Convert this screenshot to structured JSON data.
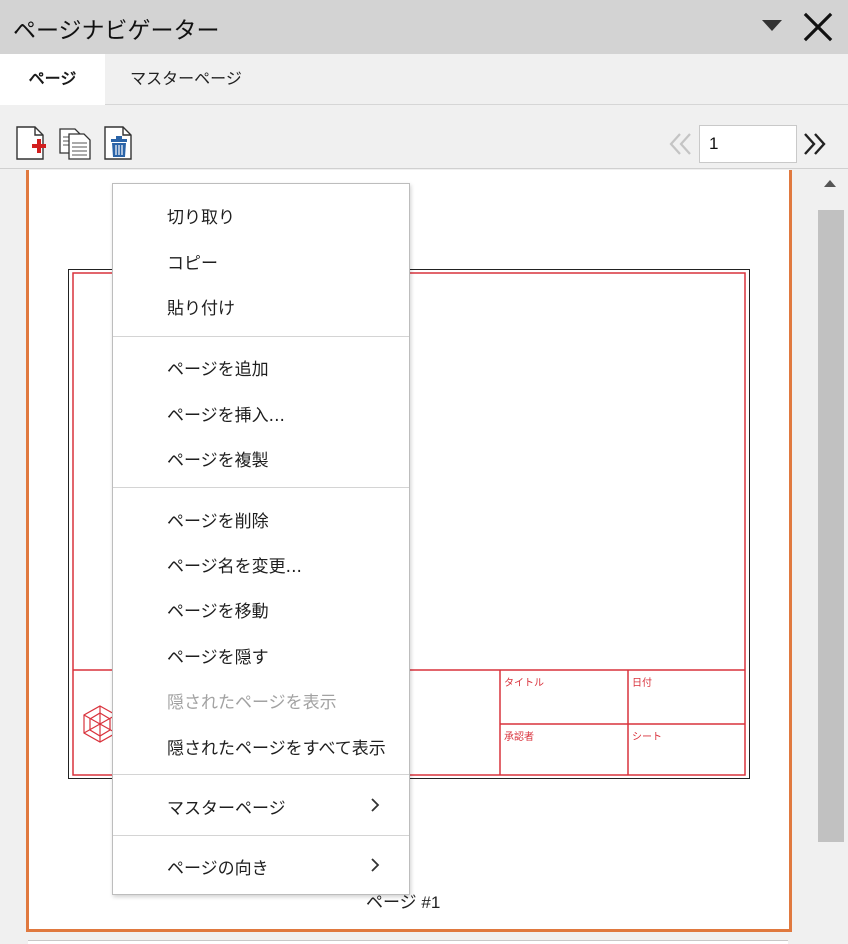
{
  "panel": {
    "title": "ページナビゲーター"
  },
  "tabs": [
    {
      "label": "ページ",
      "active": true
    },
    {
      "label": "マスターページ",
      "active": false
    }
  ],
  "toolbar": {
    "add_page_icon": "page-add-icon",
    "duplicate_icon": "page-duplicate-icon",
    "delete_icon": "page-delete-icon",
    "page_number": "1"
  },
  "page_card": {
    "label": "ページ #1",
    "border_color": "#e0793f",
    "title_block": {
      "title_label": "タイトル",
      "date_label": "日付",
      "approver_label": "承認者",
      "sheet_label": "シート"
    }
  },
  "context_menu": {
    "groups": [
      [
        {
          "label": "切り取り",
          "disabled": false
        },
        {
          "label": "コピー",
          "disabled": false
        },
        {
          "label": "貼り付け",
          "disabled": false
        }
      ],
      [
        {
          "label": "ページを追加",
          "disabled": false
        },
        {
          "label": "ページを挿入...",
          "disabled": false
        },
        {
          "label": "ページを複製",
          "disabled": false
        }
      ],
      [
        {
          "label": "ページを削除",
          "disabled": false
        },
        {
          "label": "ページ名を変更...",
          "disabled": false
        },
        {
          "label": "ページを移動",
          "disabled": false
        },
        {
          "label": "ページを隠す",
          "disabled": false
        },
        {
          "label": "隠されたページを表示",
          "disabled": true
        },
        {
          "label": "隠されたページをすべて表示",
          "disabled": false
        }
      ],
      [
        {
          "label": "マスターページ",
          "disabled": false,
          "submenu": true
        }
      ],
      [
        {
          "label": "ページの向き",
          "disabled": false,
          "submenu": true
        }
      ]
    ]
  },
  "colors": {
    "accent_orange": "#e0793f",
    "drawing_red": "#d9323c",
    "delete_blue": "#2b64a8"
  }
}
